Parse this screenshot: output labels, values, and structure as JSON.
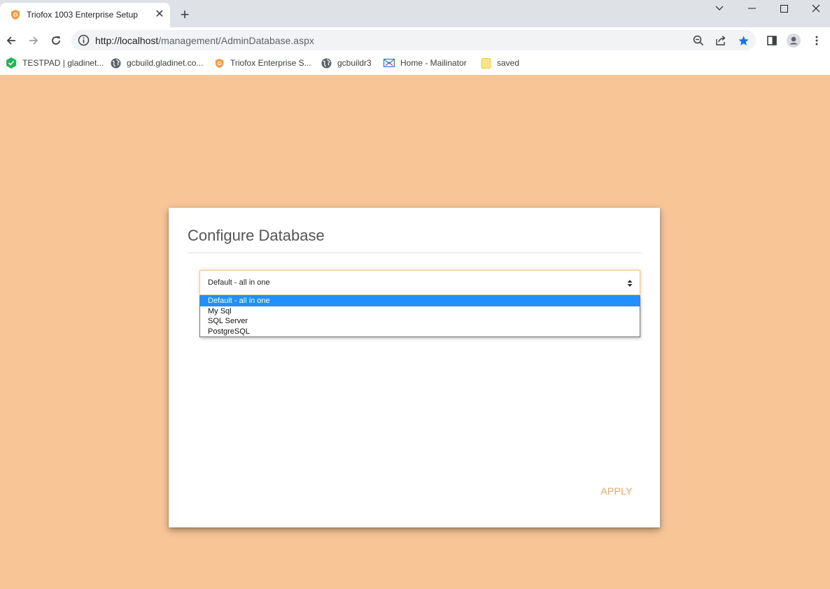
{
  "browser": {
    "tab": {
      "title": "Triofox 1003 Enterprise Setup",
      "close": "✕"
    },
    "new_tab": "+",
    "url": {
      "host": "http://localhost",
      "path": "/management/AdminDatabase.aspx"
    },
    "bookmarks": [
      {
        "label": "TESTPAD | gladinet...",
        "icon": "testpad-icon"
      },
      {
        "label": "gcbuild.gladinet.co...",
        "icon": "globe-icon"
      },
      {
        "label": "Triofox Enterprise S...",
        "icon": "triofox-icon"
      },
      {
        "label": "gcbuildr3",
        "icon": "globe-icon"
      },
      {
        "label": "Home - Mailinator",
        "icon": "mail-icon"
      },
      {
        "label": "saved",
        "icon": "folder-icon"
      }
    ]
  },
  "page": {
    "title": "Configure Database",
    "database_select": {
      "selected": "Default - all in one",
      "options": [
        "Default - all in one",
        "My Sql",
        "SQL Server",
        "PostgreSQL"
      ]
    },
    "apply_label": "APPLY"
  },
  "colors": {
    "background": "#f8c597",
    "accent": "#f7a25c",
    "selected_option": "#1e90ff"
  }
}
